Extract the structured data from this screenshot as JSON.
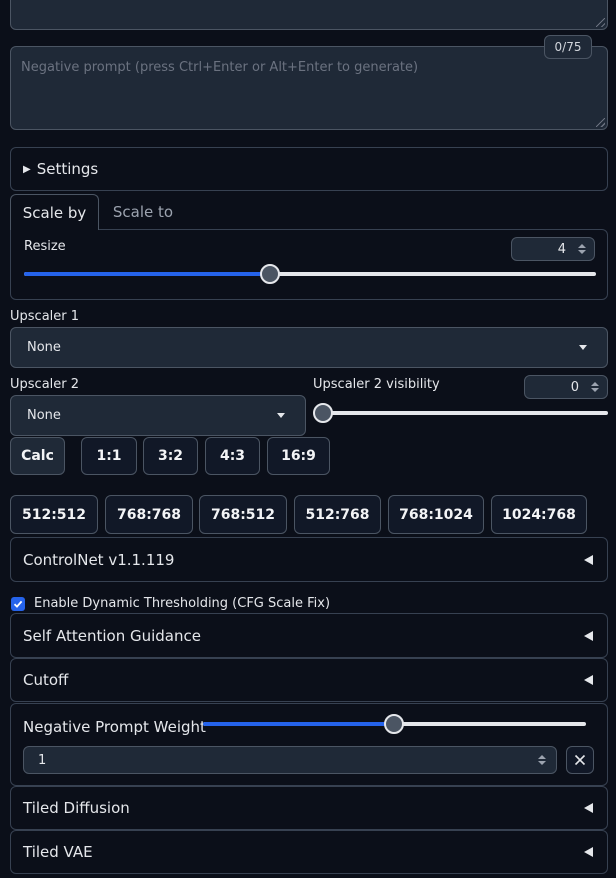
{
  "prompt": {
    "counter": "0/75"
  },
  "negative_prompt": {
    "placeholder": "Negative prompt (press Ctrl+Enter or Alt+Enter to generate)"
  },
  "settings": {
    "label": "Settings"
  },
  "tabs": [
    {
      "label": "Scale by"
    },
    {
      "label": "Scale to"
    }
  ],
  "resize": {
    "label": "Resize",
    "value": "4",
    "slider_fraction": 0.48
  },
  "upscaler1": {
    "label": "Upscaler 1",
    "value": "None"
  },
  "upscaler2": {
    "label": "Upscaler 2",
    "value": "None"
  },
  "upscaler2_visibility": {
    "label": "Upscaler 2 visibility",
    "value": "0",
    "slider_fraction": 0.0
  },
  "ratio_buttons": [
    "Calc",
    "1:1",
    "3:2",
    "4:3",
    "16:9"
  ],
  "size_buttons": [
    "512:512",
    "768:768",
    "768:512",
    "512:768",
    "768:1024",
    "1024:768"
  ],
  "controlnet": {
    "label": "ControlNet v1.1.119"
  },
  "dynamic_thresholding": {
    "label": "Enable Dynamic Thresholding (CFG Scale Fix)",
    "checked": true
  },
  "self_attention": {
    "label": "Self Attention Guidance"
  },
  "cutoff": {
    "label": "Cutoff"
  },
  "negative_weight": {
    "label": "Negative Prompt Weight",
    "value": "1",
    "slider_fraction": 0.5
  },
  "tiled_diffusion": {
    "label": "Tiled Diffusion"
  },
  "tiled_vae": {
    "label": "Tiled VAE"
  },
  "colors": {
    "background": "#0b0f19",
    "accent": "#2563eb",
    "border": "#374151"
  }
}
